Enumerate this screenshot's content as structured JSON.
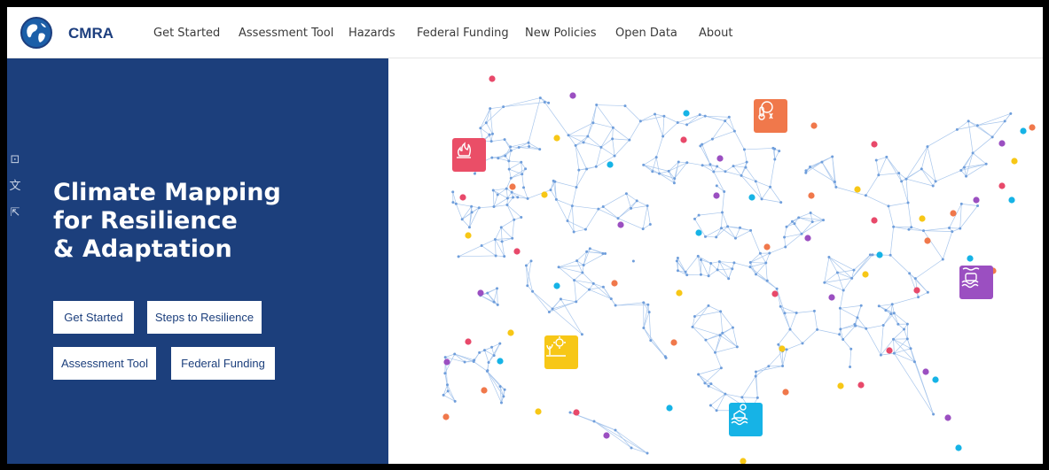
{
  "brand": {
    "name": "CMRA"
  },
  "nav": {
    "items": [
      {
        "label": "Get Started"
      },
      {
        "label": "Assessment Tool"
      },
      {
        "label": "Hazards"
      },
      {
        "label": "Federal Funding"
      },
      {
        "label": "New Policies"
      },
      {
        "label": "Open Data"
      },
      {
        "label": "About"
      }
    ]
  },
  "hero": {
    "title_lines": [
      "Climate Mapping",
      "for Resilience",
      "& Adaptation"
    ],
    "buttons": [
      {
        "label": "Get Started"
      },
      {
        "label": "Steps to Resilience"
      },
      {
        "label": "Assessment Tool"
      },
      {
        "label": "Federal Funding"
      }
    ]
  },
  "side_tools": [
    {
      "icon": "rss-icon",
      "glyph": "⊡"
    },
    {
      "icon": "translate-icon",
      "glyph": "文"
    },
    {
      "icon": "share-icon",
      "glyph": "⇱"
    }
  ],
  "hazard_icons": [
    {
      "icon": "wildfire-icon",
      "color": "#ea4e67"
    },
    {
      "icon": "extreme-heat-thermometer-icon",
      "color": "#f0784b"
    },
    {
      "icon": "coastal-inundation-icon",
      "color": "#9b4fc1"
    },
    {
      "icon": "drought-sun-icon",
      "color": "#f7c716"
    },
    {
      "icon": "flooding-waves-icon",
      "color": "#16b3e6"
    }
  ],
  "colors": {
    "hero_bg": "#1c3f7c",
    "brand": "#1c3e7e",
    "network_line": "#a8c6ec",
    "dot_red": "#e8496a",
    "dot_orange": "#f0784b",
    "dot_purple": "#9b4fc1",
    "dot_yellow": "#f7c716",
    "dot_blue": "#16b3e6"
  }
}
